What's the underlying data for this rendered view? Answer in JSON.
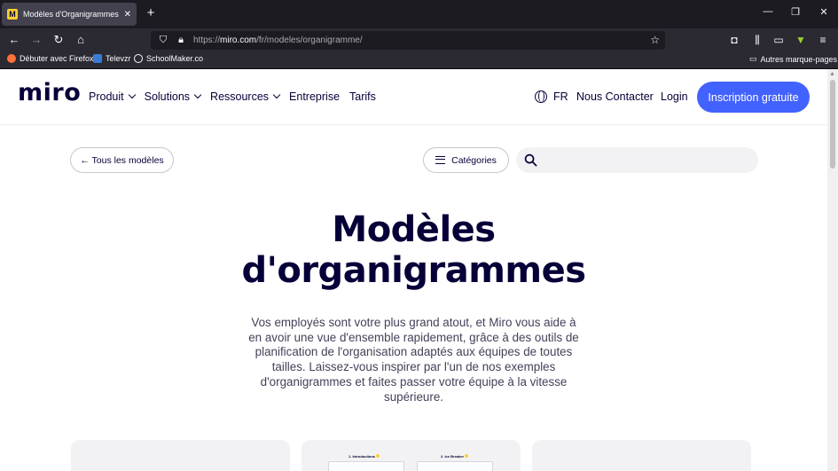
{
  "browser": {
    "tab_title": "Modèles d'Organigrammes et E",
    "favicon_letter": "M",
    "url_prefix": "https://",
    "url_domain": "miro.com",
    "url_path": "/fr/modeles/organigramme/",
    "bookmarks": [
      "Débuter avec Firefox",
      "Televzr",
      "SchoolMaker.co"
    ],
    "other_bookmarks": "Autres marque-pages"
  },
  "header": {
    "logo": "miro",
    "menu": [
      {
        "label": "Produit",
        "dropdown": true
      },
      {
        "label": "Solutions",
        "dropdown": true
      },
      {
        "label": "Ressources",
        "dropdown": true
      },
      {
        "label": "Entreprise",
        "dropdown": false
      },
      {
        "label": "Tarifs",
        "dropdown": false
      }
    ],
    "language": "FR",
    "contact": "Nous Contacter",
    "login": "Login",
    "signup": "Inscription gratuite"
  },
  "filters": {
    "back_label": "← Tous les modèles",
    "categories_label": "Catégories",
    "search_placeholder": ""
  },
  "hero": {
    "title_line1": "Modèles",
    "title_line2": "d'organigrammes",
    "description": "Vos employés sont votre plus grand atout, et Miro vous aide à en avoir une vue d'ensemble rapidement, grâce à des outils de planification de l'organisation adaptés aux équipes de toutes tailles. Laissez-vous inspirer par l'un de nos exemples d'organigrammes et faites passer votre équipe à la vitesse supérieure."
  },
  "cards": [
    {
      "steps": []
    },
    {
      "steps": [
        "1. Introductions",
        "2. Ice Breaker"
      ]
    },
    {
      "steps": []
    }
  ]
}
